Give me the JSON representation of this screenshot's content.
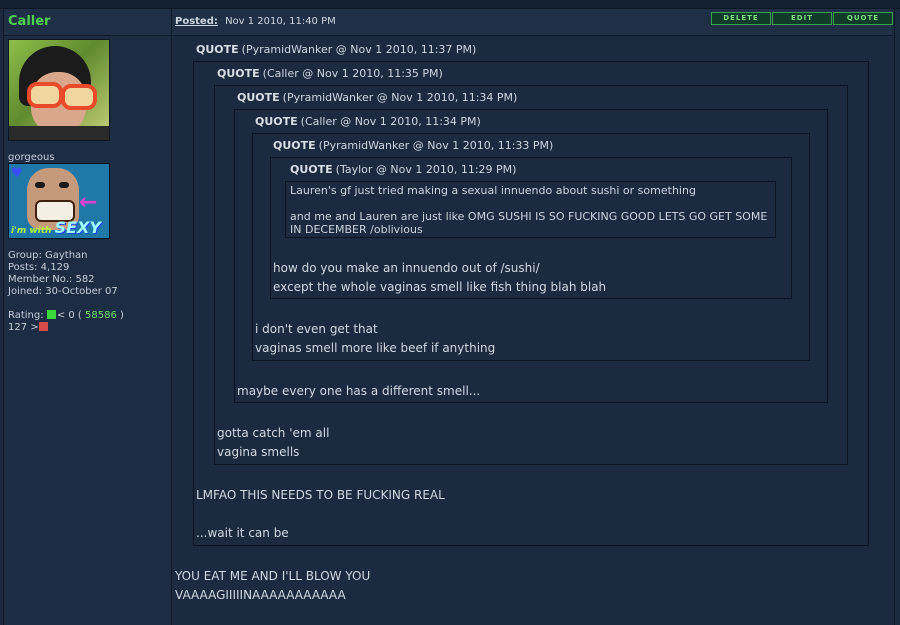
{
  "post": {
    "author": "Caller",
    "posted_label": "Posted:",
    "posted_date": "Nov 1 2010, 11:40 PM",
    "buttons": {
      "delete": "DELETE",
      "edit": "EDIT",
      "quote": "QUOTE"
    }
  },
  "sidebar": {
    "user_title": "gorgeous",
    "badge_text": "i'm with",
    "badge_text2": "SEXY",
    "group": "Group: Gaythan",
    "posts": "Posts: 4,129",
    "member_no": "Member No.: 582",
    "joined": "Joined: 30-October 07",
    "rating_label": "Rating:",
    "rating_mid": "< 0 (",
    "rating_num": "58586",
    "rating_close": ")",
    "rating_line2": "127 >"
  },
  "quotes": {
    "q1": {
      "label": "QUOTE",
      "meta": "(PyramidWanker @ Nov 1 2010, 11:37 PM)"
    },
    "q2": {
      "label": "QUOTE",
      "meta": "(Caller @ Nov 1 2010, 11:35 PM)"
    },
    "q3": {
      "label": "QUOTE",
      "meta": "(PyramidWanker @ Nov 1 2010, 11:34 PM)"
    },
    "q4": {
      "label": "QUOTE",
      "meta": "(Caller @ Nov 1 2010, 11:34 PM)"
    },
    "q5": {
      "label": "QUOTE",
      "meta": "(PyramidWanker @ Nov 1 2010, 11:33 PM)"
    },
    "q6": {
      "label": "QUOTE",
      "meta": "(Taylor @ Nov 1 2010, 11:29 PM)",
      "line1": "Lauren's gf just tried making a sexual innuendo about sushi or something",
      "line2": "and me and Lauren are just like OMG SUSHI IS SO FUCKING GOOD LETS GO GET SOME IN DECEMBER /oblivious"
    }
  },
  "replies": {
    "r5_l1": "how do you make an innuendo out of /sushi/",
    "r5_l2": "except the whole vaginas smell like fish thing blah blah",
    "r4_l1": "i don't even get that",
    "r4_l2": "vaginas smell more like beef if anything",
    "r3_l1": "maybe every one has a different smell...",
    "r2_l1": "gotta catch 'em all",
    "r2_l2": "vagina smells",
    "r1_l1": "LMFAO THIS NEEDS TO BE FUCKING REAL",
    "r1_l2": "...wait it can be",
    "main_l1": "YOU EAT ME AND I'LL BLOW YOU",
    "main_l2": "VAAAAGIIIIINAAAAAAAAAAA"
  }
}
